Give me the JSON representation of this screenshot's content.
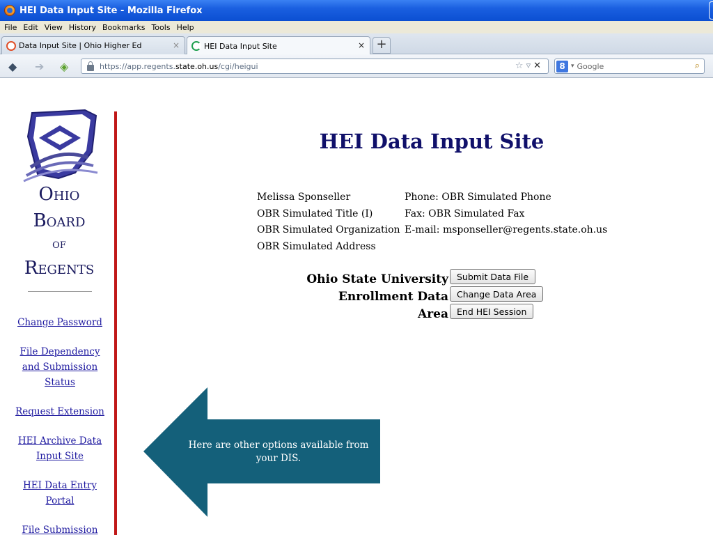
{
  "browser": {
    "window_title": "HEI Data Input Site - Mozilla Firefox",
    "menu": [
      "File",
      "Edit",
      "View",
      "History",
      "Bookmarks",
      "Tools",
      "Help"
    ],
    "tabs": [
      {
        "label": "Data Input Site | Ohio Higher Ed",
        "active": false,
        "icon": "tab-favicon-icon"
      },
      {
        "label": "HEI Data Input Site",
        "active": true,
        "icon": "loading-spinner-icon"
      }
    ],
    "new_tab": "+",
    "url_prefix": "https://app.regents.",
    "url_host": "state.oh.us",
    "url_path": "/cgi/heigui",
    "search_engine": "Google",
    "search_placeholder": "Google"
  },
  "sidebar": {
    "org_lines": [
      "Ohio",
      "Board",
      "of",
      "Regents"
    ],
    "links": [
      {
        "label": "Change Password"
      },
      {
        "label": "File Dependency and Submission Status"
      },
      {
        "label": "Request Extension"
      },
      {
        "label": "HEI Archive Data Input Site"
      },
      {
        "label": "HEI Data Entry Portal"
      },
      {
        "label": "File Submission"
      }
    ]
  },
  "main": {
    "title": "HEI Data Input Site",
    "contact": {
      "name": "Melissa Sponseller",
      "title": "OBR Simulated Title (I)",
      "organization": "OBR Simulated Organization",
      "address": "OBR Simulated Address",
      "phone": "Phone: OBR Simulated Phone",
      "fax": "Fax: OBR Simulated Fax",
      "email": "E-mail: msponseller@regents.state.oh.us"
    },
    "institution": "Ohio State University",
    "data_area": "Enrollment Data Area",
    "buttons": {
      "submit": "Submit Data File",
      "change": "Change Data Area",
      "end": "End HEI Session"
    }
  },
  "callout": {
    "text": "Here are other options available from your DIS.",
    "color": "#14607a"
  },
  "colors": {
    "title_blue": "#10106a",
    "link_blue": "#1f1aa0",
    "divider_red": "#c01818"
  }
}
